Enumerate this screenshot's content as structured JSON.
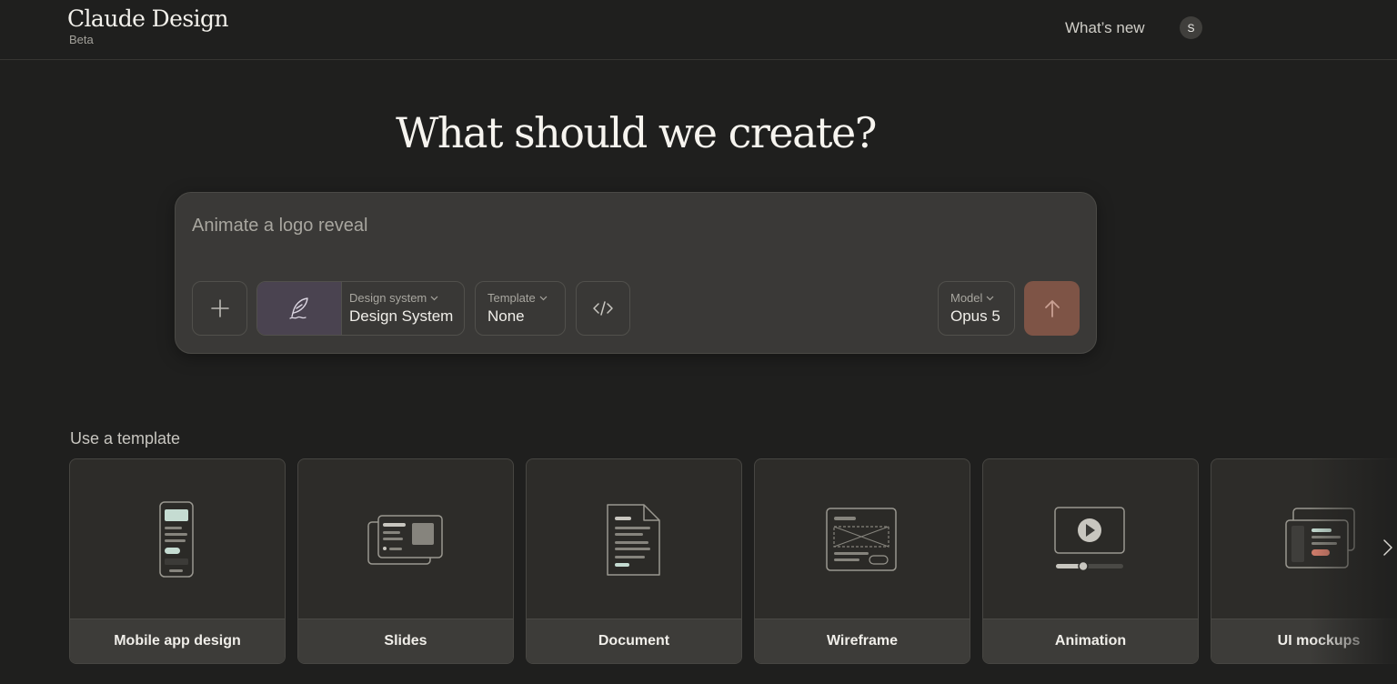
{
  "header": {
    "brand_name": "Claude Design",
    "brand_badge": "Beta",
    "whats_new": "What’s new",
    "avatar_initial": "S"
  },
  "hero": {
    "title": "What should we create?"
  },
  "composer": {
    "placeholder": "Animate a logo reveal",
    "add_icon": "plus-icon",
    "design_system": {
      "caption": "Design system",
      "value": "Design System",
      "icon": "quill-icon"
    },
    "template": {
      "caption": "Template",
      "value": "None"
    },
    "code_icon": "code-icon",
    "model": {
      "caption": "Model",
      "value": "Opus 5"
    },
    "send_icon": "arrow-up-icon",
    "send_color": "#7e5446"
  },
  "templates": {
    "label": "Use a template",
    "items": [
      {
        "label": "Mobile app design",
        "icon": "mobile-app-icon"
      },
      {
        "label": "Slides",
        "icon": "slides-icon"
      },
      {
        "label": "Document",
        "icon": "document-icon"
      },
      {
        "label": "Wireframe",
        "icon": "wireframe-icon"
      },
      {
        "label": "Animation",
        "icon": "animation-icon"
      },
      {
        "label": "UI mockups",
        "icon": "ui-mockups-icon"
      }
    ],
    "next_icon": "chevron-right-icon"
  },
  "colors": {
    "background": "#1f1f1e",
    "panel": "#3a3937",
    "card": "#2d2c29",
    "accent_mint": "#c5dcd2",
    "accent_coral": "#d47e6c"
  }
}
